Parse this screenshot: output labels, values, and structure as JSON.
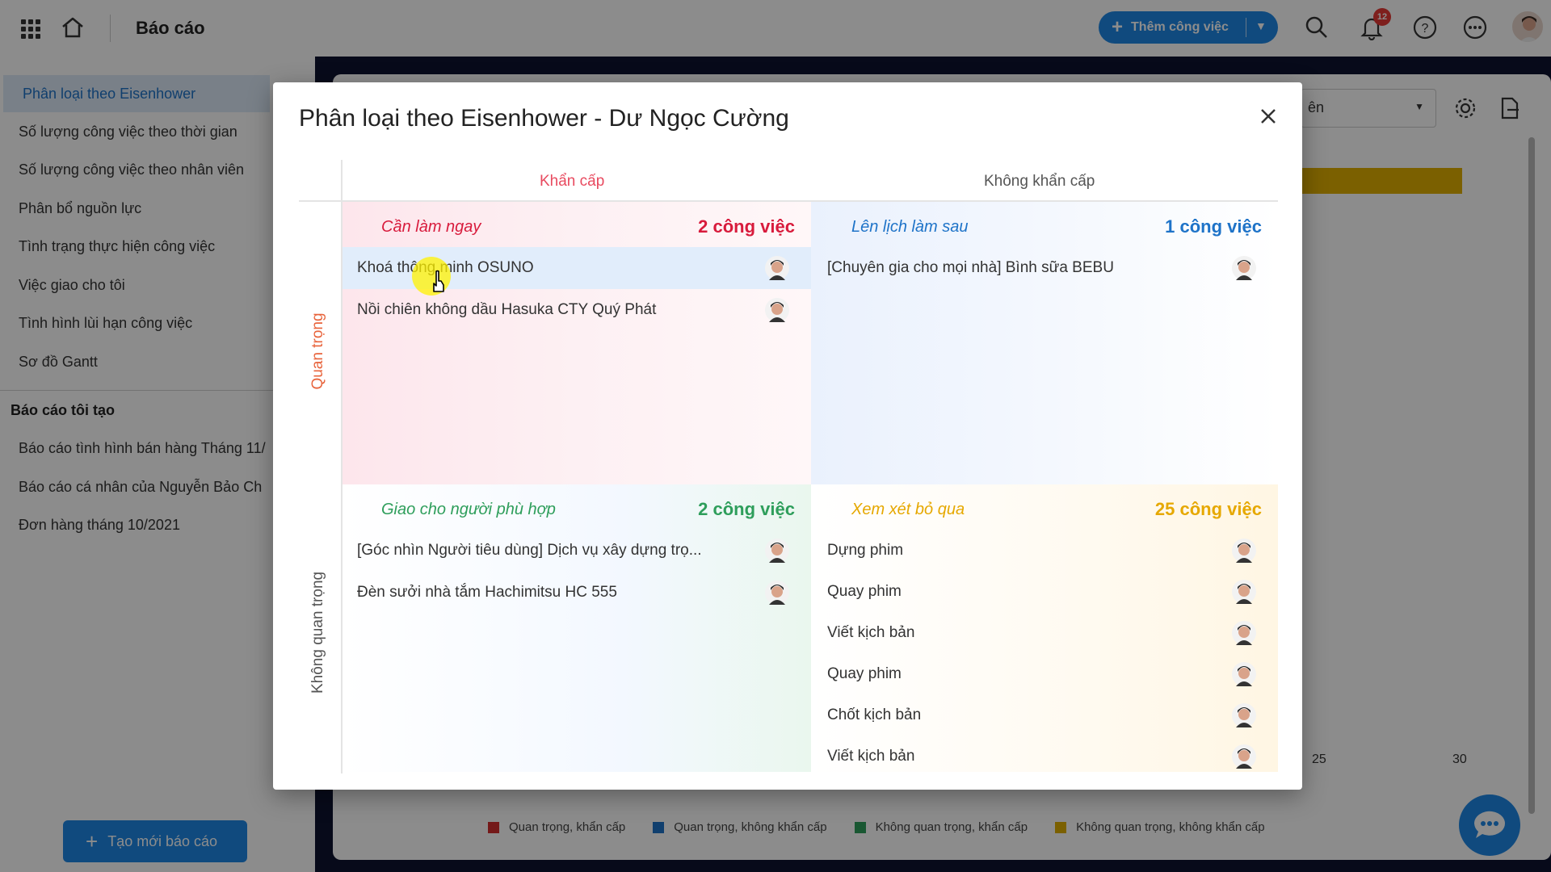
{
  "header": {
    "title": "Báo cáo",
    "add_button_label": "Thêm công việc",
    "notification_count": "12"
  },
  "sidebar": {
    "items": [
      {
        "label": "Phân loại theo Eisenhower"
      },
      {
        "label": "Số lượng công việc theo thời gian"
      },
      {
        "label": "Số lượng công việc theo nhân viên"
      },
      {
        "label": "Phân bổ nguồn lực"
      },
      {
        "label": "Tình trạng thực hiện công việc"
      },
      {
        "label": "Việc giao cho tôi"
      },
      {
        "label": "Tình hình lùi hạn công việc"
      },
      {
        "label": "Sơ đồ Gantt"
      }
    ],
    "my_reports_heading": "Báo cáo tôi tạo",
    "my_reports": [
      {
        "label": "Báo cáo tình hình bán hàng Tháng 11/"
      },
      {
        "label": "Báo cáo cá nhân của Nguyễn Bảo Ch"
      },
      {
        "label": "Đơn hàng tháng 10/2021"
      }
    ],
    "new_report_label": "Tạo mới báo cáo"
  },
  "background": {
    "select_value": "ên",
    "axis_ticks": [
      "25",
      "30"
    ],
    "legend": [
      {
        "label": "Quan trọng, khẩn cấp",
        "color": "#d32f2f"
      },
      {
        "label": "Quan trọng, không khẩn cấp",
        "color": "#1e73c8"
      },
      {
        "label": "Không quan trọng, khẩn cấp",
        "color": "#2e9e5b"
      },
      {
        "label": "Không quan trọng, không khẩn cấp",
        "color": "#e0b000"
      }
    ]
  },
  "modal": {
    "title": "Phân loại theo Eisenhower - Dư Ngọc Cường",
    "col_urgent": "Khẩn cấp",
    "col_not_urgent": "Không khẩn cấp",
    "row_important": "Quan trọng",
    "row_not_important": "Không quan trọng",
    "quadrants": {
      "do_now": {
        "name": "Cần làm ngay",
        "count": "2 công việc",
        "color": "#d81b3c",
        "tasks": [
          "Khoá thông minh OSUNO",
          "Nồi chiên không dầu Hasuka CTY Quý Phát"
        ]
      },
      "schedule": {
        "name": "Lên lịch làm sau",
        "count": "1 công việc",
        "color": "#1e73c8",
        "tasks": [
          "[Chuyên gia cho mọi nhà] Bình sữa BEBU"
        ]
      },
      "delegate": {
        "name": "Giao cho người phù hợp",
        "count": "2 công việc",
        "color": "#2e9e5b",
        "tasks": [
          "[Góc nhìn Người tiêu dùng] Dịch vụ xây dựng trọ...",
          "Đèn sưởi nhà tắm Hachimitsu HC 555"
        ]
      },
      "eliminate": {
        "name": "Xem xét bỏ qua",
        "count": "25 công việc",
        "color": "#e6a800",
        "tasks": [
          "Dựng phim",
          "Quay phim",
          "Viết kịch bản",
          "Quay phim",
          "Chốt kịch bản",
          "Viết kịch bản"
        ]
      }
    }
  },
  "colors": {
    "accent": "#1e88e5",
    "header_urgent": "#e84a5f",
    "header_not_urgent": "#555555",
    "row_important": "#e8643c",
    "row_not_important": "#555555"
  }
}
